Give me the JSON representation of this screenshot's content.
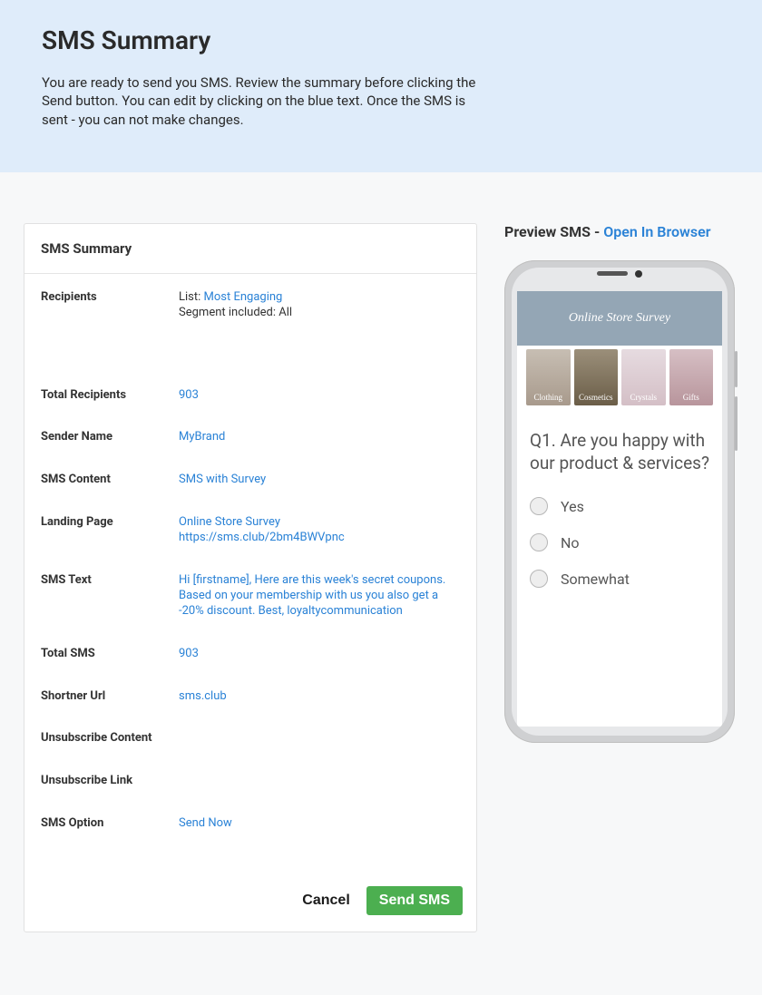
{
  "hero": {
    "title": "SMS Summary",
    "description": "You are ready to send you SMS. Review the summary before clicking the Send button. You can edit by clicking on the blue text. Once the SMS is sent - you can not make changes."
  },
  "card": {
    "title": "SMS Summary",
    "rows": {
      "recipients": {
        "label": "Recipients",
        "prefix": "List: ",
        "link": "Most Engaging",
        "suffix": "Segment included: All"
      },
      "total_recipients": {
        "label": "Total Recipients",
        "value": "903"
      },
      "sender_name": {
        "label": "Sender Name",
        "value": "MyBrand"
      },
      "sms_content": {
        "label": "SMS Content",
        "value": "SMS with Survey"
      },
      "landing_page": {
        "label": "Landing Page",
        "line1": "Online Store Survey",
        "line2": "https://sms.club/2bm4BWVpnc"
      },
      "sms_text": {
        "label": "SMS Text",
        "value": "Hi [firstname], Here are this week's secret coupons. Based on your membership with us you also get a -20% discount. Best, loyaltycommunication"
      },
      "total_sms": {
        "label": "Total SMS",
        "value": "903"
      },
      "shortner_url": {
        "label": "Shortner Url",
        "value": "sms.club"
      },
      "unsubscribe_content": {
        "label": "Unsubscribe Content",
        "value": ""
      },
      "unsubscribe_link": {
        "label": "Unsubscribe Link",
        "value": ""
      },
      "sms_option": {
        "label": "SMS Option",
        "value": "Send Now"
      }
    },
    "footer": {
      "cancel": "Cancel",
      "send": "Send SMS"
    }
  },
  "preview": {
    "title_prefix": "Preview SMS - ",
    "open_link": "Open In Browser",
    "survey": {
      "header": "Online Store Survey",
      "thumbs": [
        "Clothing",
        "Cosmetics",
        "Crystals",
        "Gifts"
      ],
      "question": "Q1. Are you happy with our product & services?",
      "options": [
        "Yes",
        "No",
        "Somewhat"
      ]
    }
  }
}
